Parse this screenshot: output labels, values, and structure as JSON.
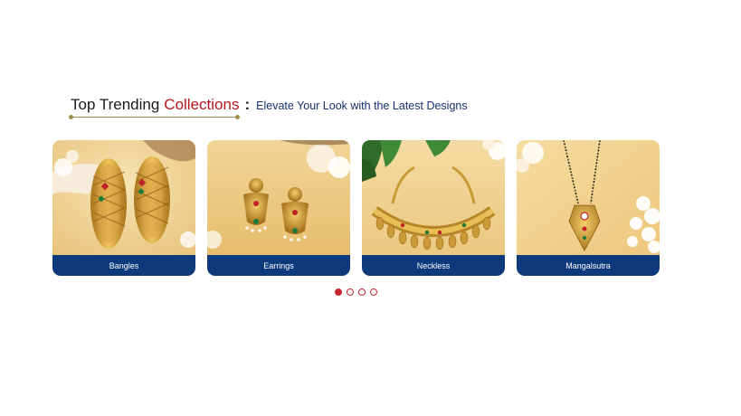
{
  "section": {
    "title": "Top Trending",
    "title_accent": "Collections",
    "separator": ":",
    "subtitle": "Elevate Your Look with the Latest Designs"
  },
  "cards": [
    {
      "label": "Bangles",
      "image": "bangles-image"
    },
    {
      "label": "Earrings",
      "image": "earrings-image"
    },
    {
      "label": "Neckless",
      "image": "necklace-image"
    },
    {
      "label": "Mangalsutra",
      "image": "mangalsutra-image"
    }
  ],
  "pagination": {
    "total": 4,
    "active": 1
  },
  "colors": {
    "accent_red": "#b3151d",
    "label_bar": "#0c3a7d",
    "subtitle": "#17306e",
    "gold": "#d4a437"
  }
}
